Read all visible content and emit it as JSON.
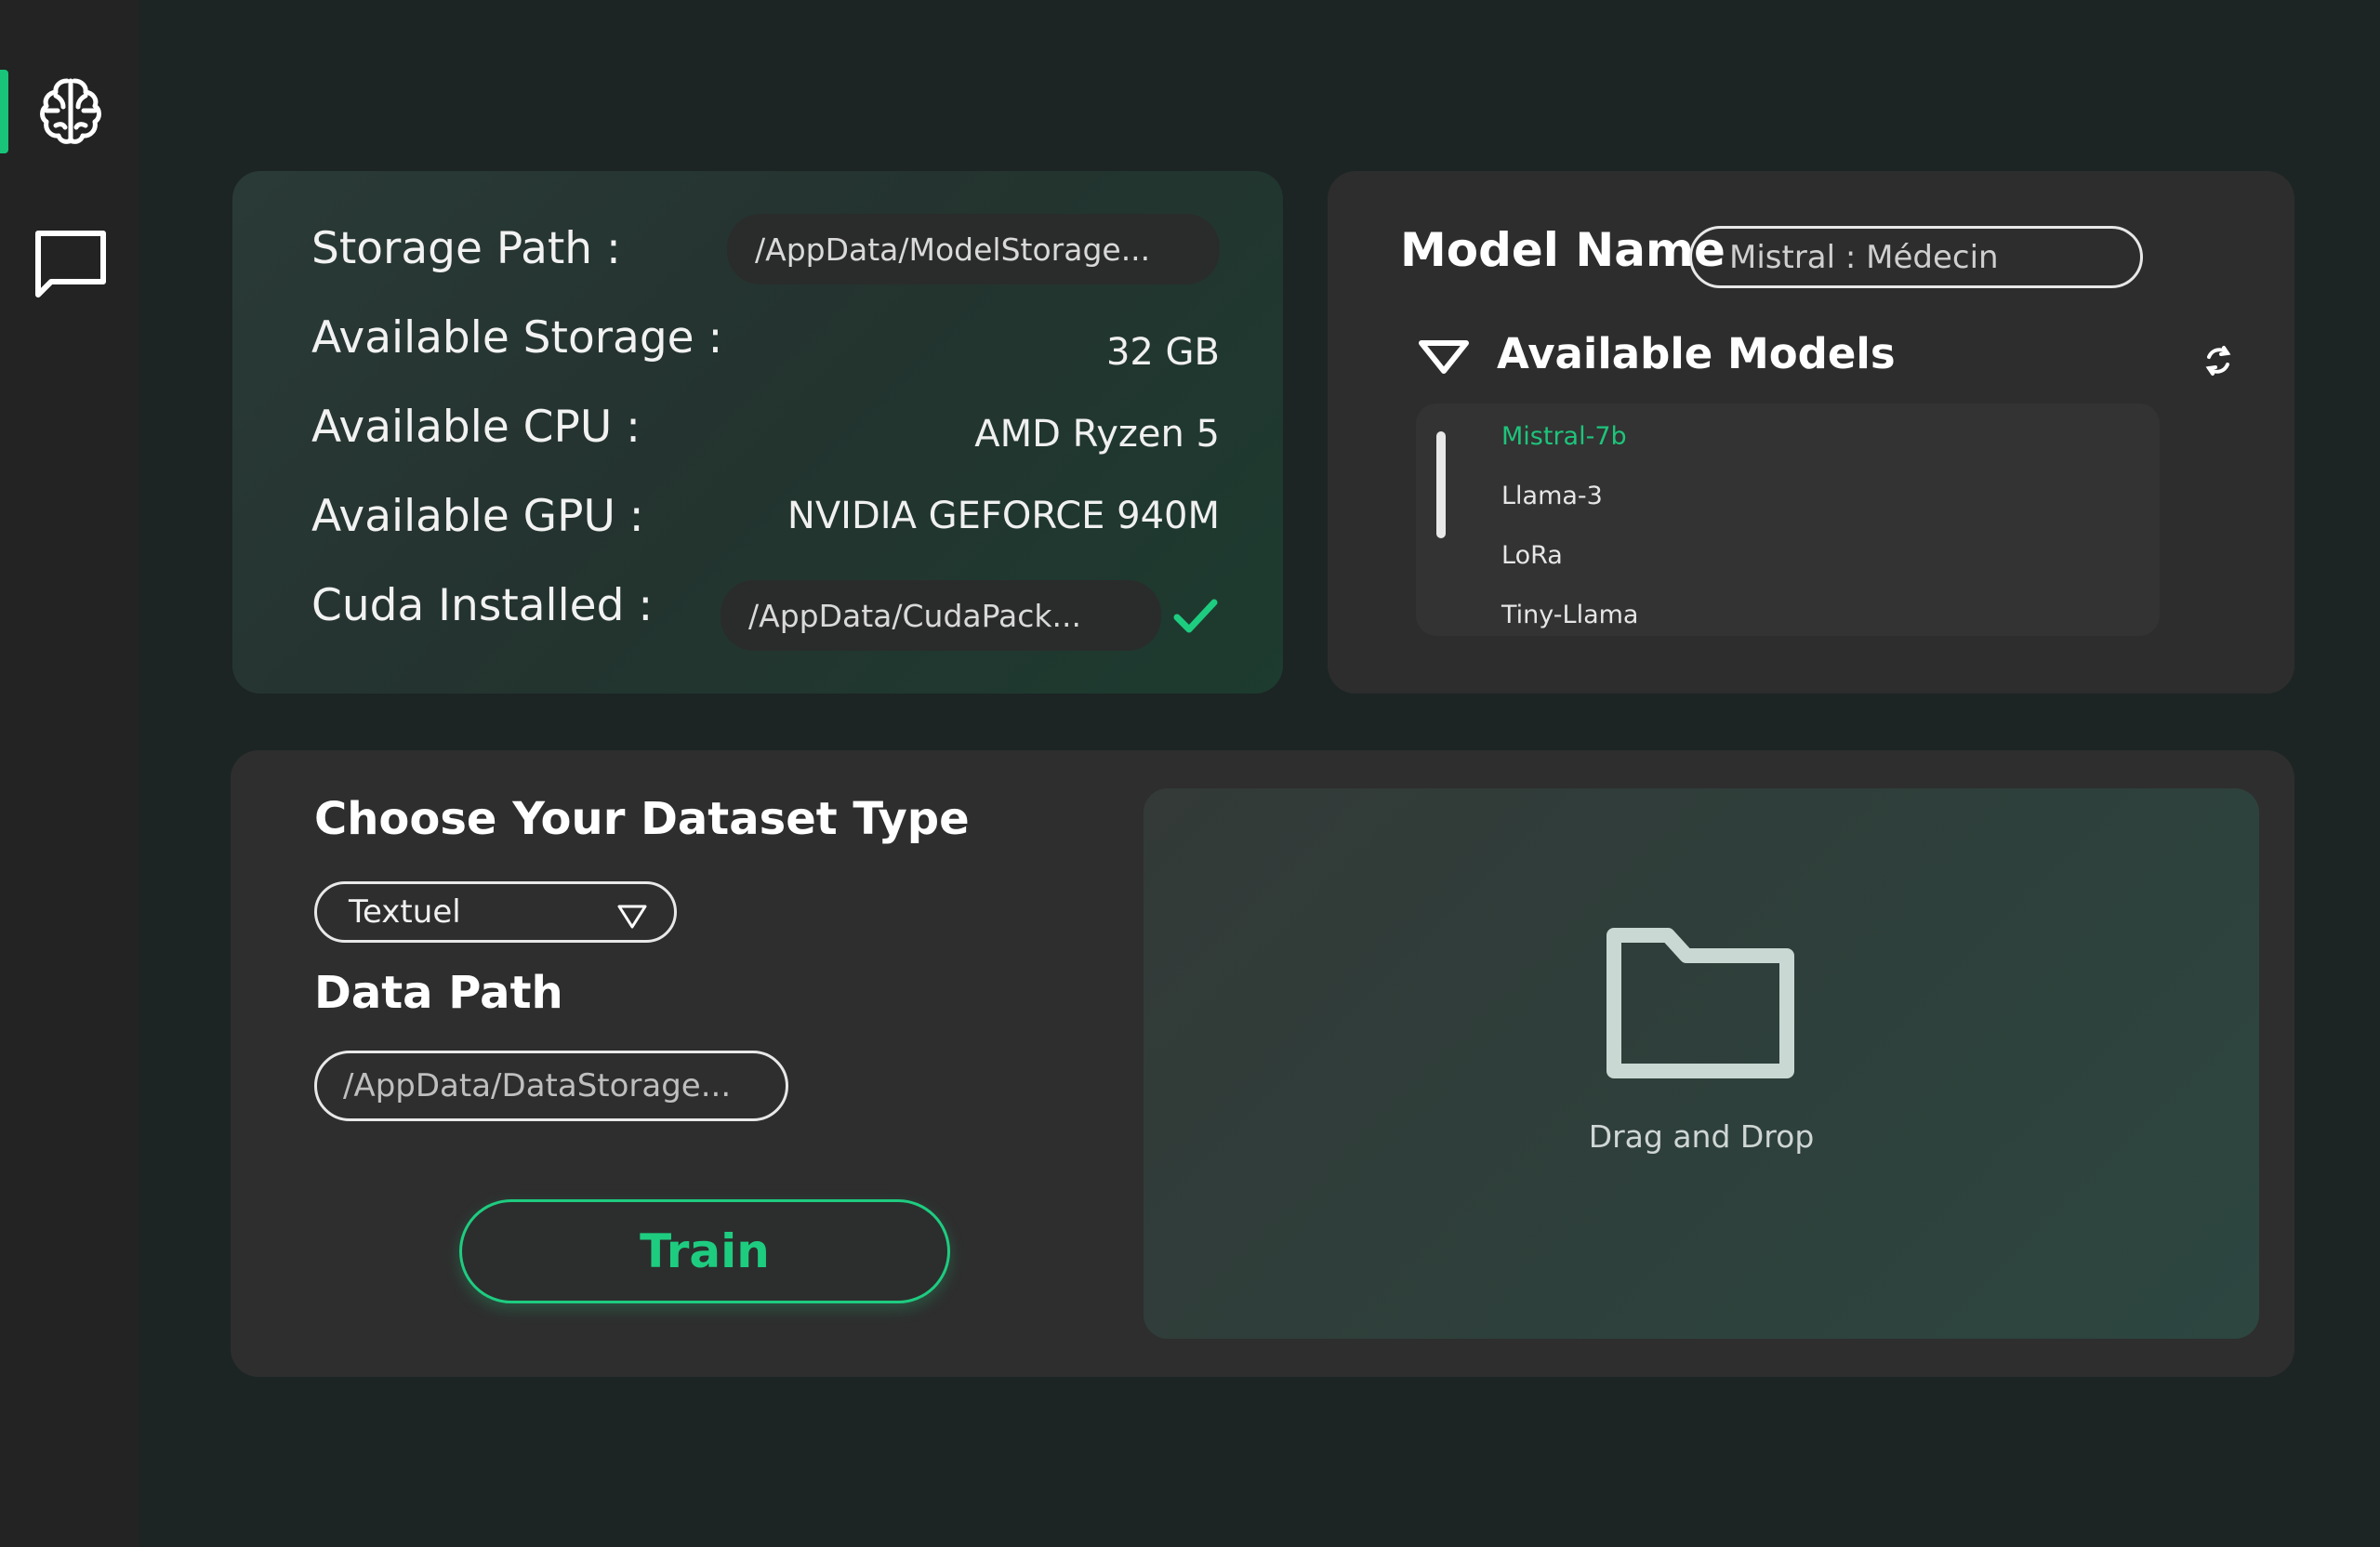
{
  "sidebar": {
    "items": [
      {
        "icon": "brain-icon",
        "active": true
      },
      {
        "icon": "chat-icon",
        "active": false
      }
    ]
  },
  "system_info": {
    "storage_path_label": "Storage Path :",
    "storage_path_value": "/AppData/ModelStorage...",
    "available_storage_label": "Available Storage :",
    "available_storage_value": "32 GB",
    "available_cpu_label": "Available CPU :",
    "available_cpu_value": "AMD Ryzen 5",
    "available_gpu_label": "Available GPU :",
    "available_gpu_value": "NVIDIA GEFORCE 940M",
    "cuda_label": "Cuda Installed :",
    "cuda_path_value": "/AppData/CudaPack...",
    "cuda_status_icon": "check-icon"
  },
  "model": {
    "name_label": "Model Name",
    "name_value": "Mistral : Médecin",
    "available_models_title": "Available Models",
    "models": [
      "Mistral-7b",
      "Llama-3",
      "LoRa",
      "Tiny-Llama"
    ],
    "selected_model": "Mistral-7b"
  },
  "dataset": {
    "type_title": "Choose Your Dataset Type",
    "type_selected": "Textuel",
    "data_path_title": "Data Path",
    "data_path_placeholder": "/AppData/DataStorage...",
    "train_label": "Train",
    "drop_label": "Drag and Drop"
  },
  "colors": {
    "accent": "#1ecc80",
    "background": "#1c2524",
    "panel": "#2e2e2e"
  }
}
